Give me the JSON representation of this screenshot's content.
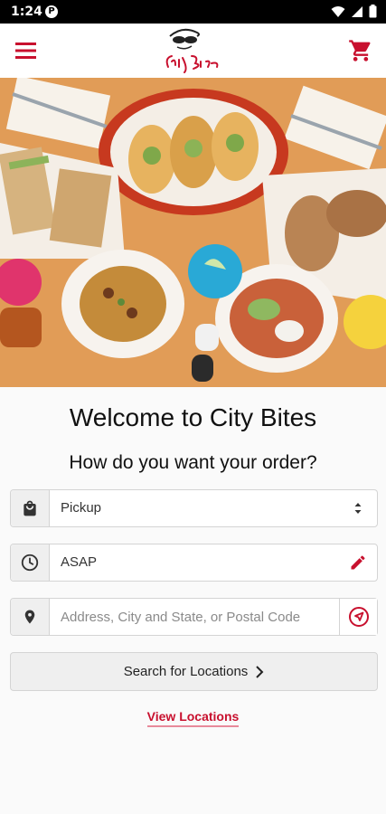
{
  "status_bar": {
    "time": "1:24",
    "notification_badge": "P"
  },
  "brand": {
    "logo_text": "City Bites",
    "accent_color": "#c8102e"
  },
  "hero": {
    "image": "food-platter-photo"
  },
  "main": {
    "welcome": "Welcome to City Bites",
    "question": "How do you want your order?",
    "order_type": {
      "value": "Pickup"
    },
    "time": {
      "value": "ASAP"
    },
    "address": {
      "placeholder": "Address, City and State, or Postal Code"
    },
    "search_button": "Search for Locations",
    "view_locations": "View Locations"
  }
}
